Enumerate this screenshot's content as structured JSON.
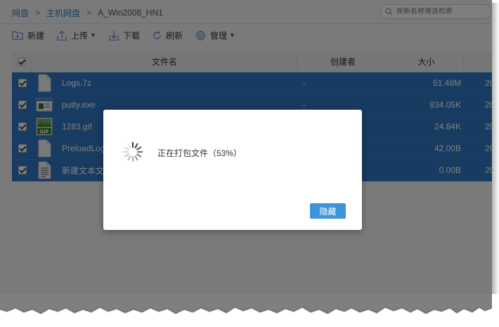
{
  "breadcrumb": {
    "items": [
      "网盘",
      "主机网盘",
      "A_Win2008_HN1"
    ],
    "separator": ">"
  },
  "search": {
    "placeholder": "按新名称筛选检索"
  },
  "toolbar": {
    "new_label": "新建",
    "upload_label": "上传",
    "download_label": "下载",
    "refresh_label": "刷新",
    "manage_label": "管理"
  },
  "table": {
    "headers": {
      "name": "文件名",
      "owner": "创建者",
      "size": "大小"
    },
    "rows": [
      {
        "icon": "zip-file-icon",
        "name": "Logs.7z",
        "owner": "-",
        "size": "51.48M",
        "date": "20"
      },
      {
        "icon": "exe-file-icon",
        "name": "putty.exe",
        "owner": "-",
        "size": "834.05K",
        "date": "20"
      },
      {
        "icon": "gif-file-icon",
        "name": "1283.gif",
        "owner": "",
        "size": "24.84K",
        "date": "20"
      },
      {
        "icon": "generic-file-icon",
        "name": "PreloadLog",
        "owner": "",
        "size": "42.00B",
        "date": "20"
      },
      {
        "icon": "text-file-icon",
        "name": "新建文本文档",
        "owner": "",
        "size": "0.00B",
        "date": "20"
      }
    ]
  },
  "modal": {
    "message": "正在打包文件（53%）",
    "progress_percent": 53,
    "hide_label": "隐藏"
  },
  "colors": {
    "selection": "#2f77c2",
    "link": "#3b7fc4",
    "primary_button": "#3d95d9",
    "overlay": "rgba(0,0,0,0.5)"
  }
}
